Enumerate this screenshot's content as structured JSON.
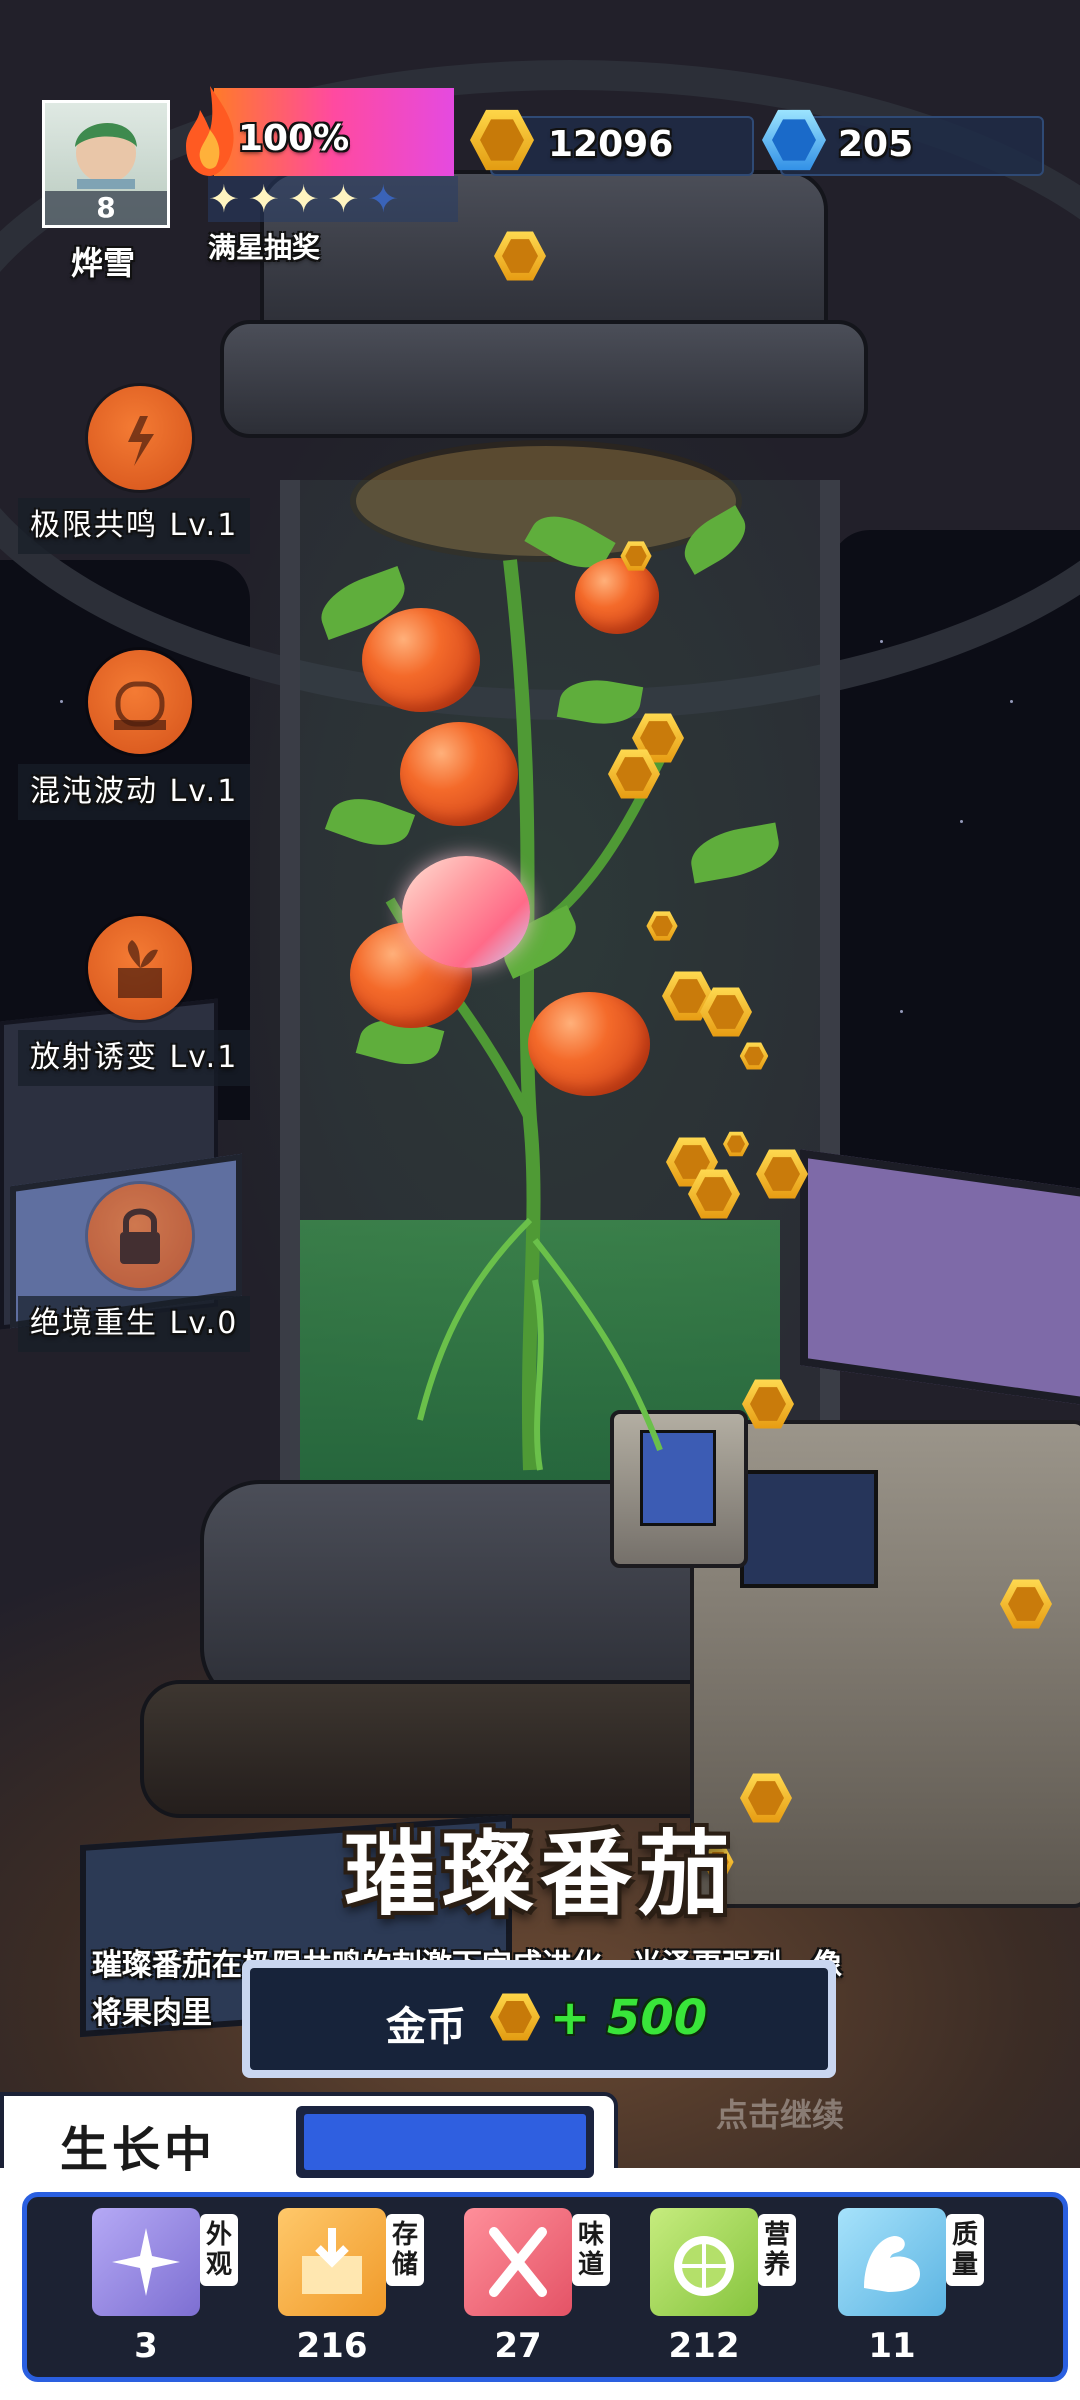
{
  "player": {
    "level": "8",
    "name": "烨雪"
  },
  "energy": {
    "percent_label": "100%",
    "stars_filled": 4,
    "stars_total": 5,
    "lottery_label": "满星抽奖"
  },
  "currency": {
    "gold": "12096",
    "gems": "205"
  },
  "skills": [
    {
      "label": "极限共鸣 Lv.1",
      "icon": "lightning-fruit-icon"
    },
    {
      "label": "混沌波动 Lv.1",
      "icon": "plant-pod-icon"
    },
    {
      "label": "放射诱变 Lv.1",
      "icon": "sprout-box-icon"
    },
    {
      "label": "绝境重生 Lv.0",
      "icon": "lock-icon"
    }
  ],
  "plant": {
    "name": "璀璨番茄",
    "description_line1": "璀璨番茄在极限共鸣的刺激下完成进化，光泽更强烈，像",
    "description_line2": "将果肉里"
  },
  "reward": {
    "label": "金币",
    "amount": "+ 500"
  },
  "continue_hint": "点击继续",
  "growth": {
    "label": "生长中",
    "progress": 1.0
  },
  "stats": [
    {
      "tag": "外观",
      "value": "3",
      "color": "#9a8fe0",
      "icon": "sparkle-icon"
    },
    {
      "tag": "存储",
      "value": "216",
      "color": "#f4b24a",
      "icon": "storage-box-icon"
    },
    {
      "tag": "味道",
      "value": "27",
      "color": "#f0707e",
      "icon": "fork-spoon-icon"
    },
    {
      "tag": "营养",
      "value": "212",
      "color": "#9fd45a",
      "icon": "lemon-icon"
    },
    {
      "tag": "质量",
      "value": "11",
      "color": "#7cc8ec",
      "icon": "muscle-icon"
    }
  ],
  "colors": {
    "reward_amount": "#39e53a",
    "progress_fill": "#2f5fe0",
    "accent_orange": "#f06a2a"
  }
}
